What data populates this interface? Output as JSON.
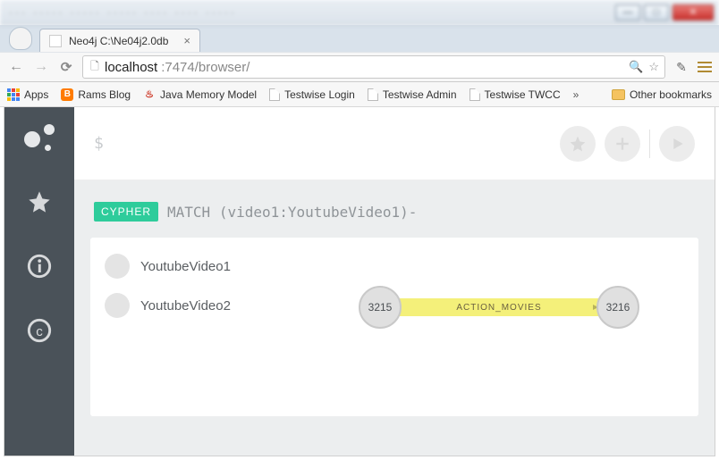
{
  "window": {
    "tab_title": "Neo4j C:\\Ne04j2.0db"
  },
  "browser": {
    "url_host": "localhost",
    "url_port_path": ":7474/browser/"
  },
  "bookmarks": {
    "apps": "Apps",
    "items": [
      "Rams Blog",
      "Java Memory Model",
      "Testwise Login",
      "Testwise Admin",
      "Testwise TWCC"
    ],
    "overflow": "»",
    "other": "Other bookmarks"
  },
  "editor": {
    "prompt": "$"
  },
  "query": {
    "badge": "CYPHER",
    "text": "MATCH (video1:YoutubeVideo1)-"
  },
  "legend": {
    "items": [
      "YoutubeVideo1",
      "YoutubeVideo2"
    ]
  },
  "graph": {
    "node_a": "3215",
    "edge_label": "ACTION_MOVIES",
    "node_b": "3216"
  }
}
